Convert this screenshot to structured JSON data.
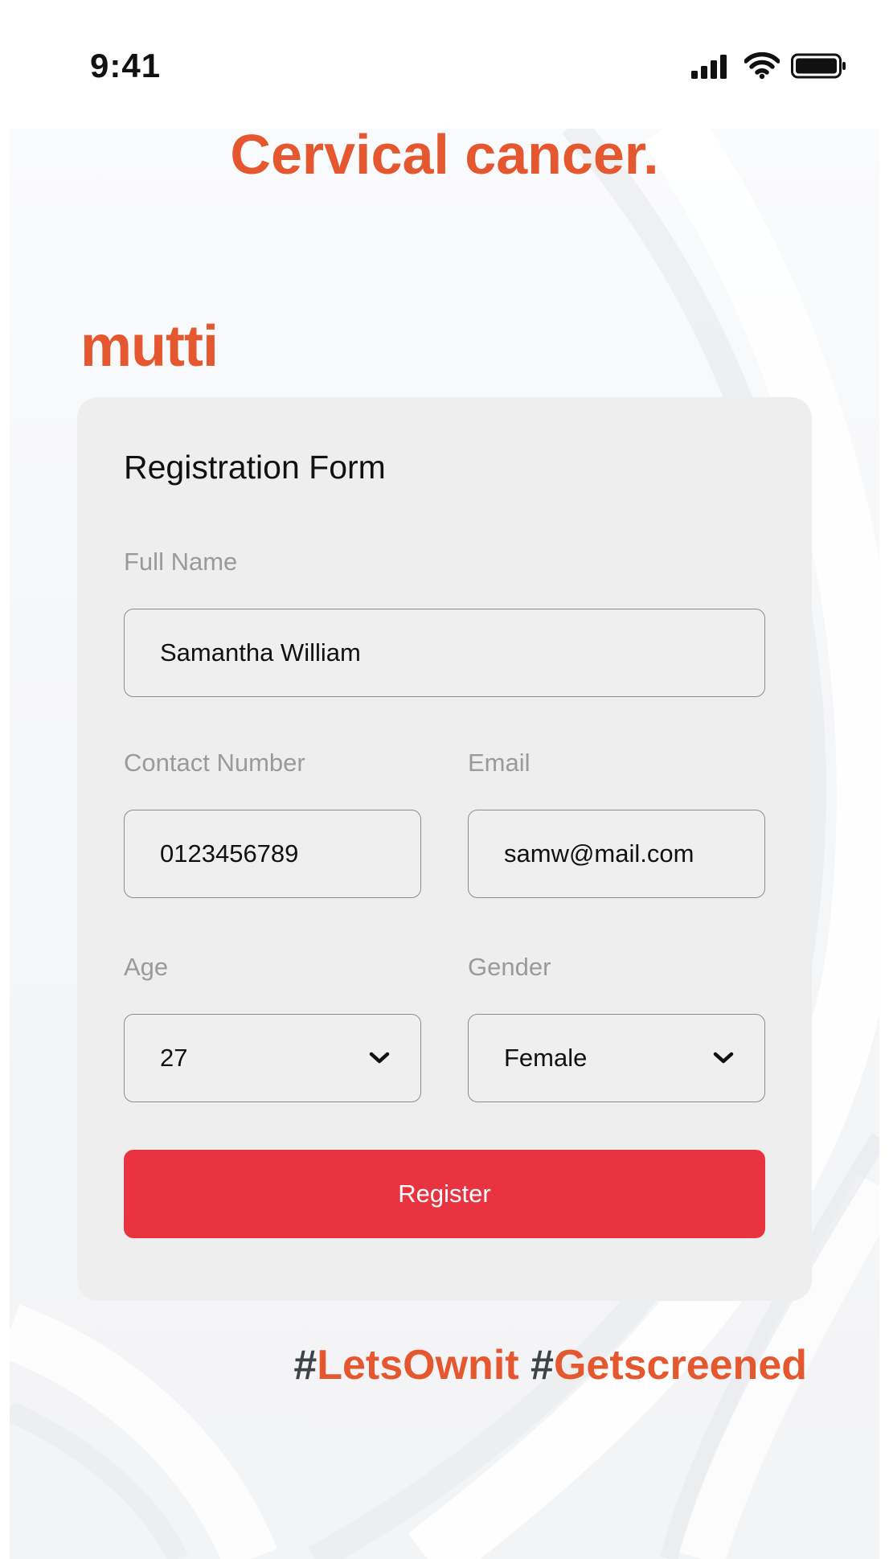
{
  "status_bar": {
    "time": "9:41",
    "icons": [
      "cellular-signal-icon",
      "wifi-icon",
      "battery-icon"
    ]
  },
  "headline": "Cervical cancer.",
  "brand": "mutti",
  "form": {
    "title": "Registration Form",
    "full_name": {
      "label": "Full Name",
      "value": "Samantha William"
    },
    "contact_number": {
      "label": "Contact Number",
      "value": "0123456789"
    },
    "email": {
      "label": "Email",
      "value": "samw@mail.com"
    },
    "age": {
      "label": "Age",
      "value": "27"
    },
    "gender": {
      "label": "Gender",
      "value": "Female"
    },
    "register_label": "Register"
  },
  "hashtags": [
    {
      "hash": "#",
      "tag": "LetsOwnit"
    },
    {
      "hash": "#",
      "tag": "Getscreened"
    }
  ],
  "colors": {
    "brand_orange": "#e5572e",
    "register_red": "#e93340",
    "card_bg": "#eeeeee",
    "label_gray": "#9a9a9a",
    "hash_dark": "#3e4347"
  }
}
